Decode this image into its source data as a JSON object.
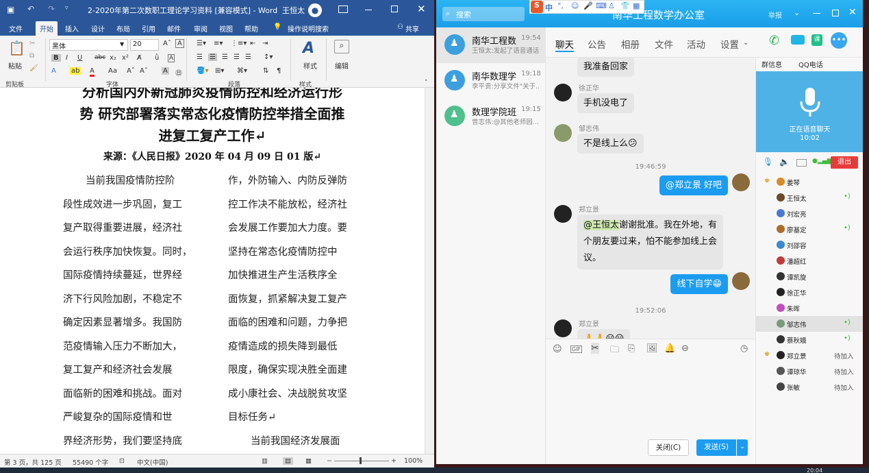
{
  "word": {
    "title": "2-2020年第二次数职工理论学习资料 [兼容模式] - Word",
    "user": "王恒太",
    "tabs": [
      "文件",
      "开始",
      "插入",
      "设计",
      "布局",
      "引用",
      "邮件",
      "审阅",
      "视图",
      "帮助"
    ],
    "tell_me": "操作说明搜索",
    "share": "共享",
    "ribbon": {
      "paste": "粘贴",
      "font_name": "黑体",
      "font_size": "20",
      "style_label": "样式",
      "edit_label": "编辑",
      "groups": [
        "剪贴板",
        "字体",
        "段落",
        "样式"
      ]
    },
    "doc": {
      "heading_lines": [
        "分析国内外新冠肺炎疫情防控和经济运行形",
        "势 研究部署落实常态化疫情防控举措全面推",
        "进复工复产工作↵"
      ],
      "source": "来源：《人民日报》2020 年 04 月 09 日 01 版↵",
      "col1": [
        "当前我国疫情防控阶",
        "段性成效进一步巩固，复工",
        "复产取得重要进展，经济社",
        "会运行秩序加快恢复。同时，",
        "国际疫情持续蔓延，世界经",
        "济下行风险加剧，不稳定不",
        "确定因素显著增多。我国防",
        "范疫情输入压力不断加大，",
        "复工复产和经济社会发展",
        "面临新的困难和挑战。面对",
        "严峻复杂的国际疫情和世",
        "界经济形势，我们要坚持底"
      ],
      "col2": [
        "作，外防输入、内防反弹防",
        "控工作决不能放松，经济社",
        "会发展工作要加大力度。要",
        "坚持在常态化疫情防控中",
        "加快推进生产生活秩序全",
        "面恢复，抓紧解决复工复产",
        "面临的困难和问题，力争把",
        "疫情造成的损失降到最低",
        "限度，确保实现决胜全面建",
        "成小康社会、决战脱贫攻坚",
        "目标任务↵",
        "当前我国经济发展面"
      ]
    },
    "status": {
      "page": "第 3 页，共 125 页",
      "words": "55490 个字",
      "lang": "中文(中国)",
      "zoom": "100%"
    }
  },
  "qq": {
    "search_placeholder": "搜索",
    "window_title": "南华工程数学办公室",
    "report": "举报",
    "ime": "中",
    "conversations": [
      {
        "name": "南华工程数学办公室",
        "time": "19:54",
        "preview": "王恒太:发起了语音通话",
        "color": "#3d9fe0"
      },
      {
        "name": "南华数理学院",
        "time": "19:18",
        "preview": "李平贵:分享文件\"关于...",
        "color": "#3d9fe0"
      },
      {
        "name": "数理学院班主任群",
        "time": "19:15",
        "preview": "曾志伟:@其他老师园...",
        "color": "#4fc08d"
      }
    ],
    "nav": [
      "聊天",
      "公告",
      "相册",
      "文件",
      "活动",
      "设置"
    ],
    "messages": [
      {
        "sender": "",
        "text": "我准备回家"
      },
      {
        "sender": "徐正华",
        "text": "手机没电了"
      },
      {
        "sender": "邹志伟",
        "text": "不是线上么😕"
      },
      {
        "time": "19:46:59"
      },
      {
        "text": "@郑立景 好吧",
        "mine": true
      },
      {
        "sender": "郑立景",
        "mention": "@王恒太",
        "lines": [
          "谢谢批准。我在外地，有",
          "个朋友要过来，怕不能参加线上会",
          "议。"
        ]
      },
      {
        "text": "线下自学😁",
        "mine": true
      },
      {
        "time": "19:52:06"
      },
      {
        "sender": "郑立景",
        "text": "🙏🙏😀😀"
      }
    ],
    "buttons": {
      "close": "关闭(C)",
      "send": "发送(S)"
    },
    "right": {
      "tabs": [
        "群信息",
        "QQ电话"
      ],
      "voice_status": "正在语音聊天",
      "voice_time": "10:02",
      "exit": "退出",
      "members": [
        {
          "name": "姜琴",
          "status": "",
          "speaking": false,
          "owner": true
        },
        {
          "name": "王恒太",
          "status": "",
          "speaking": true
        },
        {
          "name": "刘宏亮",
          "status": "",
          "speaking": false
        },
        {
          "name": "廖基定",
          "status": "",
          "speaking": true
        },
        {
          "name": "刘邵容",
          "status": "",
          "speaking": false
        },
        {
          "name": "潘超红",
          "status": "",
          "speaking": false
        },
        {
          "name": "谭凯旋",
          "status": "",
          "speaking": false
        },
        {
          "name": "徐正华",
          "status": "",
          "speaking": false
        },
        {
          "name": "朱晖",
          "status": "",
          "speaking": false
        },
        {
          "name": "邹志伟",
          "status": "",
          "speaking": true,
          "selected": true
        },
        {
          "name": "蔡秋娥",
          "status": "",
          "speaking": true
        },
        {
          "name": "郑立景",
          "status": "待加入",
          "speaking": false,
          "owner": true
        },
        {
          "name": "谭琼华",
          "status": "待加入",
          "speaking": false
        },
        {
          "name": "张敏",
          "status": "待加入",
          "speaking": false
        }
      ]
    }
  },
  "taskbar": {
    "clock": "20:04"
  }
}
